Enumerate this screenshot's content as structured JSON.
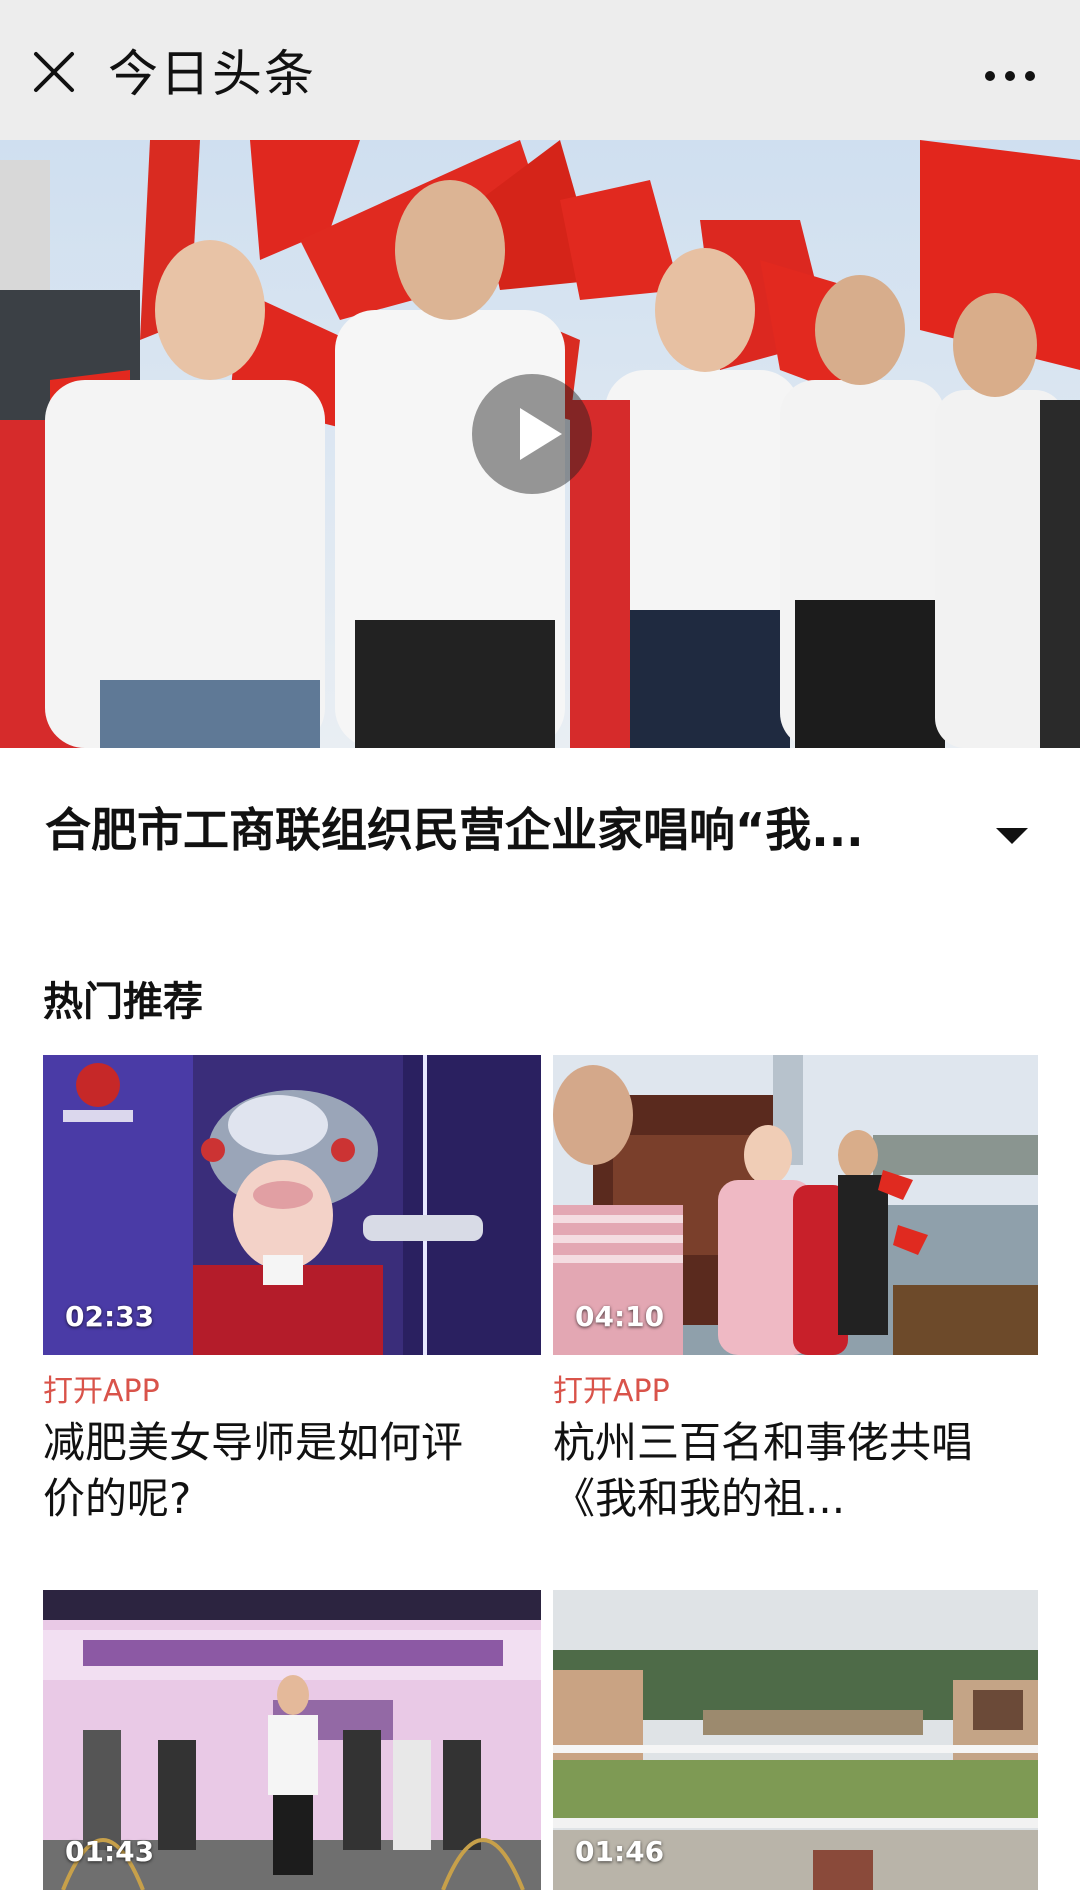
{
  "nav": {
    "title": "今日头条",
    "close_icon": "close-icon",
    "more_icon": "more-dots-icon"
  },
  "hero": {
    "play_icon": "play-icon"
  },
  "article": {
    "title": "合肥市工商联组织民营企业家唱响“我...",
    "expand_icon": "triangle-down-icon"
  },
  "section": {
    "title": "热门推荐"
  },
  "cards": [
    {
      "duration": "02:33",
      "action": "打开APP",
      "title": "减肥美女导师是如何评价的呢?"
    },
    {
      "duration": "04:10",
      "action": "打开APP",
      "title": "杭州三百名和事佬共唱《我和我的祖..."
    },
    {
      "duration": "01:43"
    },
    {
      "duration": "01:46"
    }
  ],
  "colors": {
    "topbar_bg": "#ededed",
    "accent_red": "#d9534a",
    "text": "#111111"
  }
}
